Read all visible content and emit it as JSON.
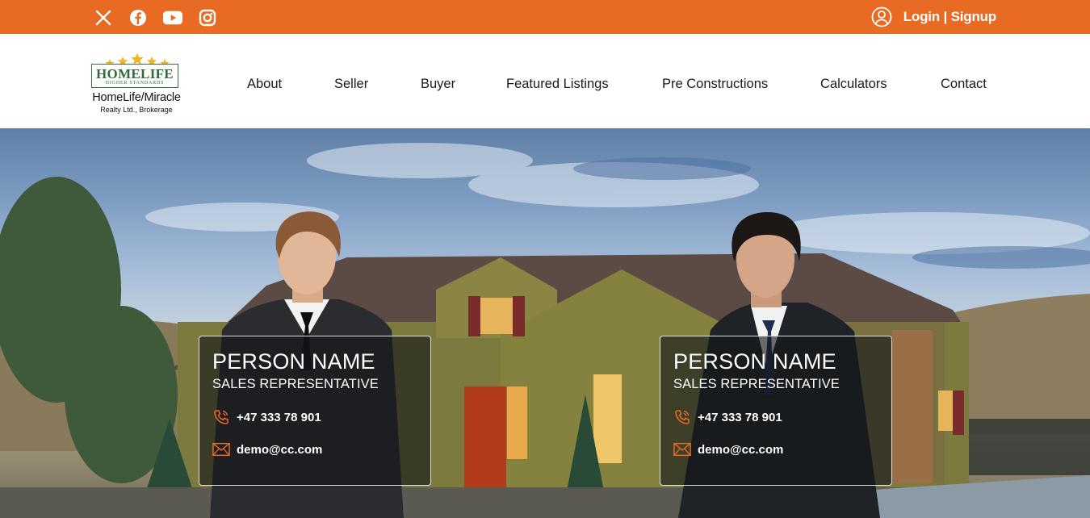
{
  "topbar": {
    "social": [
      {
        "icon": "x-twitter-icon"
      },
      {
        "icon": "facebook-icon"
      },
      {
        "icon": "youtube-icon"
      },
      {
        "icon": "instagram-icon"
      }
    ],
    "login_label": "Login | Signup",
    "accent": "#e96a22"
  },
  "logo": {
    "brand": "HOMELIFE",
    "tagline": "HIGHER STANDARDS",
    "name": "HomeLife/Miracle",
    "sub": "Realty Ltd., Brokerage"
  },
  "nav": {
    "items": [
      {
        "label": "About"
      },
      {
        "label": "Seller"
      },
      {
        "label": "Buyer"
      },
      {
        "label": "Featured Listings"
      },
      {
        "label": "Pre Constructions"
      },
      {
        "label": "Calculators"
      },
      {
        "label": "Contact"
      }
    ]
  },
  "agents": [
    {
      "name": "PERSON NAME",
      "role": "SALES REPRESENTATIVE",
      "phone": "+47 333 78 901",
      "email": "demo@cc.com"
    },
    {
      "name": "PERSON NAME",
      "role": "SALES REPRESENTATIVE",
      "phone": "+47 333 78 901",
      "email": "demo@cc.com"
    }
  ]
}
